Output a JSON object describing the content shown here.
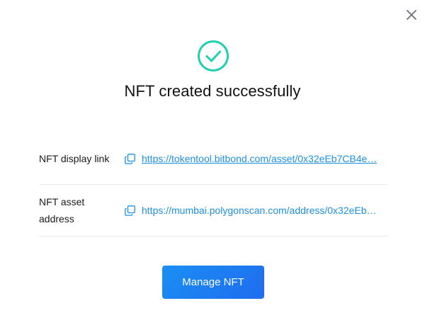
{
  "colors": {
    "accent_teal": "#1fcfae",
    "link_blue": "#1e8fe0",
    "button_blue": "#1a8ff2",
    "divider": "#e6e8eb"
  },
  "dialog": {
    "close_icon": "close-icon",
    "success_icon": "check-circle-icon",
    "title": "NFT created successfully",
    "rows": [
      {
        "label": "NFT display link",
        "icon": "copy-icon",
        "link": "https://tokentool.bitbond.com/asset/0x32eEb7CB4e…"
      },
      {
        "label": "NFT asset address",
        "icon": "copy-icon",
        "link": "https://mumbai.polygonscan.com/address/0x32eEb…"
      }
    ],
    "primary_button": "Manage NFT"
  }
}
